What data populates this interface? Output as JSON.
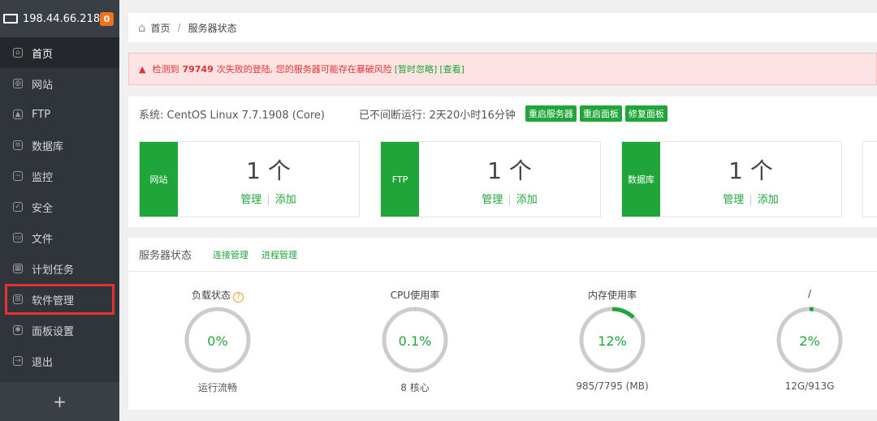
{
  "sidebar": {
    "ip": "198.44.66.218",
    "badge": "0",
    "items": [
      {
        "label": "首页",
        "icon": "home-icon"
      },
      {
        "label": "网站",
        "icon": "globe-icon"
      },
      {
        "label": "FTP",
        "icon": "ftp-icon"
      },
      {
        "label": "数据库",
        "icon": "database-icon"
      },
      {
        "label": "监控",
        "icon": "monitor-icon"
      },
      {
        "label": "安全",
        "icon": "shield-icon"
      },
      {
        "label": "文件",
        "icon": "folder-icon"
      },
      {
        "label": "计划任务",
        "icon": "calendar-icon"
      },
      {
        "label": "软件管理",
        "icon": "apps-icon"
      },
      {
        "label": "面板设置",
        "icon": "gear-icon"
      },
      {
        "label": "退出",
        "icon": "logout-icon"
      }
    ],
    "add": "+"
  },
  "breadcrumb": {
    "home": "首页",
    "sep": "/",
    "current": "服务器状态"
  },
  "alert": {
    "pre": "检测到",
    "count": "79749",
    "msg": "次失败的登陆, 您的服务器可能存在暴破风险",
    "ignore": "[暂时忽略]",
    "view": "[查看]"
  },
  "system": {
    "os": "系统: CentOS Linux 7.7.1908 (Core)",
    "uptime": "已不间断运行: 2天20小时16分钟",
    "buttons": [
      "重启服务器",
      "重启面板",
      "修复面板"
    ]
  },
  "cards": [
    {
      "label": "网站",
      "count": "1 个",
      "manage": "管理",
      "add": "添加"
    },
    {
      "label": "FTP",
      "count": "1 个",
      "manage": "管理",
      "add": "添加"
    },
    {
      "label": "数据库",
      "count": "1 个",
      "manage": "管理",
      "add": "添加"
    }
  ],
  "status": {
    "title": "服务器状态",
    "links": [
      "连接管理",
      "进程管理"
    ],
    "gauges": [
      {
        "title": "负载状态",
        "value": "0%",
        "pct": 0,
        "sub": "运行流畅"
      },
      {
        "title": "CPU使用率",
        "value": "0.1%",
        "pct": 0.1,
        "sub": "8 核心"
      },
      {
        "title": "内存使用率",
        "value": "12%",
        "pct": 12,
        "sub": "985/7795 (MB)"
      },
      {
        "title": "/",
        "value": "2%",
        "pct": 2,
        "sub": "12G/913G"
      }
    ]
  },
  "colors": {
    "green": "#20a53a",
    "alert": "#e13232",
    "sidebar": "#30353b"
  }
}
